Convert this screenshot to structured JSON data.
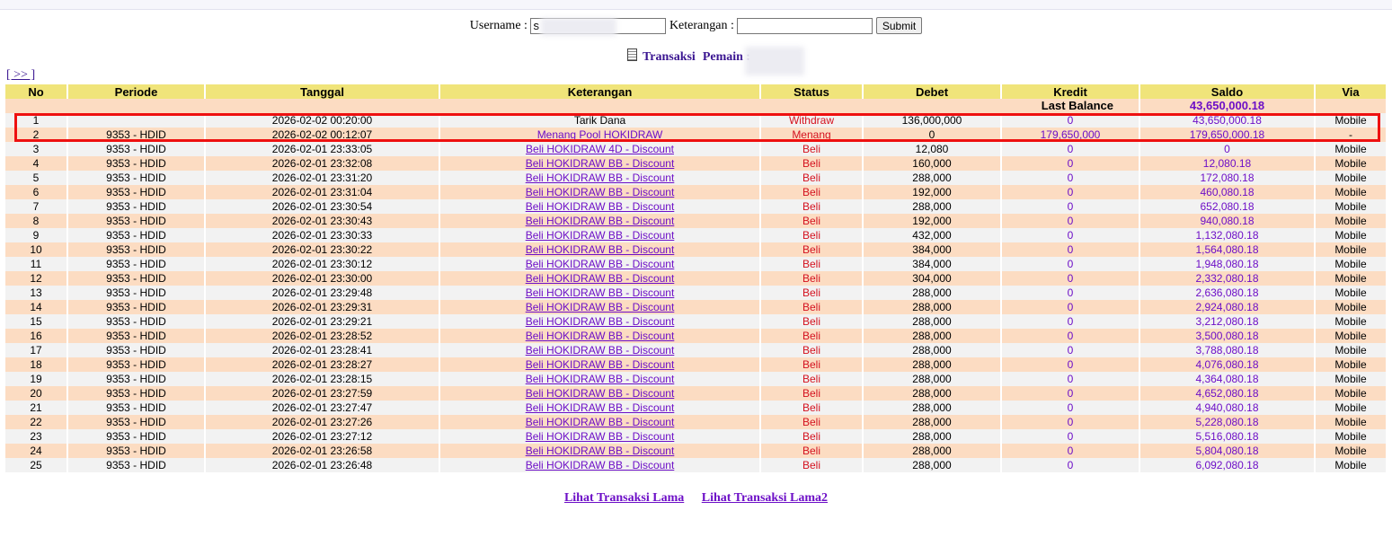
{
  "form": {
    "username_label": "Username :",
    "username_value": "s",
    "keterangan_label": "Keterangan :",
    "keterangan_value": "",
    "submit_label": "Submit"
  },
  "title": {
    "transaksi": "Transaksi",
    "pemain": "Pemain : sa"
  },
  "pager": "[ >> ]",
  "columns": [
    "No",
    "Periode",
    "Tanggal",
    "Keterangan",
    "Status",
    "Debet",
    "Kredit",
    "Saldo",
    "Via"
  ],
  "last_balance": {
    "label": "Last Balance",
    "value": "43,650,000.18"
  },
  "rows": [
    [
      "1",
      "",
      "2026-02-02 00:20:00",
      "Tarik Dana",
      "Withdraw",
      "136,000,000",
      "0",
      "43,650,000.18",
      "Mobile"
    ],
    [
      "2",
      "9353 - HDID",
      "2026-02-02 00:12:07",
      "Menang Pool HOKIDRAW",
      "Menang",
      "0",
      "179,650,000",
      "179,650,000.18",
      "-"
    ],
    [
      "3",
      "9353 - HDID",
      "2026-02-01 23:33:05",
      "Beli HOKIDRAW 4D - Discount",
      "Beli",
      "12,080",
      "0",
      "0",
      "Mobile"
    ],
    [
      "4",
      "9353 - HDID",
      "2026-02-01 23:32:08",
      "Beli HOKIDRAW BB - Discount",
      "Beli",
      "160,000",
      "0",
      "12,080.18",
      "Mobile"
    ],
    [
      "5",
      "9353 - HDID",
      "2026-02-01 23:31:20",
      "Beli HOKIDRAW BB - Discount",
      "Beli",
      "288,000",
      "0",
      "172,080.18",
      "Mobile"
    ],
    [
      "6",
      "9353 - HDID",
      "2026-02-01 23:31:04",
      "Beli HOKIDRAW BB - Discount",
      "Beli",
      "192,000",
      "0",
      "460,080.18",
      "Mobile"
    ],
    [
      "7",
      "9353 - HDID",
      "2026-02-01 23:30:54",
      "Beli HOKIDRAW BB - Discount",
      "Beli",
      "288,000",
      "0",
      "652,080.18",
      "Mobile"
    ],
    [
      "8",
      "9353 - HDID",
      "2026-02-01 23:30:43",
      "Beli HOKIDRAW BB - Discount",
      "Beli",
      "192,000",
      "0",
      "940,080.18",
      "Mobile"
    ],
    [
      "9",
      "9353 - HDID",
      "2026-02-01 23:30:33",
      "Beli HOKIDRAW BB - Discount",
      "Beli",
      "432,000",
      "0",
      "1,132,080.18",
      "Mobile"
    ],
    [
      "10",
      "9353 - HDID",
      "2026-02-01 23:30:22",
      "Beli HOKIDRAW BB - Discount",
      "Beli",
      "384,000",
      "0",
      "1,564,080.18",
      "Mobile"
    ],
    [
      "11",
      "9353 - HDID",
      "2026-02-01 23:30:12",
      "Beli HOKIDRAW BB - Discount",
      "Beli",
      "384,000",
      "0",
      "1,948,080.18",
      "Mobile"
    ],
    [
      "12",
      "9353 - HDID",
      "2026-02-01 23:30:00",
      "Beli HOKIDRAW BB - Discount",
      "Beli",
      "304,000",
      "0",
      "2,332,080.18",
      "Mobile"
    ],
    [
      "13",
      "9353 - HDID",
      "2026-02-01 23:29:48",
      "Beli HOKIDRAW BB - Discount",
      "Beli",
      "288,000",
      "0",
      "2,636,080.18",
      "Mobile"
    ],
    [
      "14",
      "9353 - HDID",
      "2026-02-01 23:29:31",
      "Beli HOKIDRAW BB - Discount",
      "Beli",
      "288,000",
      "0",
      "2,924,080.18",
      "Mobile"
    ],
    [
      "15",
      "9353 - HDID",
      "2026-02-01 23:29:21",
      "Beli HOKIDRAW BB - Discount",
      "Beli",
      "288,000",
      "0",
      "3,212,080.18",
      "Mobile"
    ],
    [
      "16",
      "9353 - HDID",
      "2026-02-01 23:28:52",
      "Beli HOKIDRAW BB - Discount",
      "Beli",
      "288,000",
      "0",
      "3,500,080.18",
      "Mobile"
    ],
    [
      "17",
      "9353 - HDID",
      "2026-02-01 23:28:41",
      "Beli HOKIDRAW BB - Discount",
      "Beli",
      "288,000",
      "0",
      "3,788,080.18",
      "Mobile"
    ],
    [
      "18",
      "9353 - HDID",
      "2026-02-01 23:28:27",
      "Beli HOKIDRAW BB - Discount",
      "Beli",
      "288,000",
      "0",
      "4,076,080.18",
      "Mobile"
    ],
    [
      "19",
      "9353 - HDID",
      "2026-02-01 23:28:15",
      "Beli HOKIDRAW BB - Discount",
      "Beli",
      "288,000",
      "0",
      "4,364,080.18",
      "Mobile"
    ],
    [
      "20",
      "9353 - HDID",
      "2026-02-01 23:27:59",
      "Beli HOKIDRAW BB - Discount",
      "Beli",
      "288,000",
      "0",
      "4,652,080.18",
      "Mobile"
    ],
    [
      "21",
      "9353 - HDID",
      "2026-02-01 23:27:47",
      "Beli HOKIDRAW BB - Discount",
      "Beli",
      "288,000",
      "0",
      "4,940,080.18",
      "Mobile"
    ],
    [
      "22",
      "9353 - HDID",
      "2026-02-01 23:27:26",
      "Beli HOKIDRAW BB - Discount",
      "Beli",
      "288,000",
      "0",
      "5,228,080.18",
      "Mobile"
    ],
    [
      "23",
      "9353 - HDID",
      "2026-02-01 23:27:12",
      "Beli HOKIDRAW BB - Discount",
      "Beli",
      "288,000",
      "0",
      "5,516,080.18",
      "Mobile"
    ],
    [
      "24",
      "9353 - HDID",
      "2026-02-01 23:26:58",
      "Beli HOKIDRAW BB - Discount",
      "Beli",
      "288,000",
      "0",
      "5,804,080.18",
      "Mobile"
    ],
    [
      "25",
      "9353 - HDID",
      "2026-02-01 23:26:48",
      "Beli HOKIDRAW BB - Discount",
      "Beli",
      "288,000",
      "0",
      "6,092,080.18",
      "Mobile"
    ]
  ],
  "footer": {
    "link1": "Lihat Transaksi Lama",
    "link2": "Lihat Transaksi Lama2"
  },
  "colors": {
    "header_bg": "#f0e47a",
    "row_even": "#fcdcc2",
    "row_odd": "#f2f2f2",
    "link": "#6d0fc7",
    "status": "#d4111e",
    "highlight_border": "#ee1010"
  },
  "icons": {
    "title_icon": "document-icon"
  }
}
